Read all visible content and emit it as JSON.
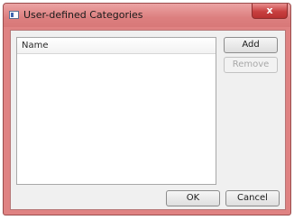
{
  "window": {
    "title": "User-defined Categories",
    "close_label": "x"
  },
  "list": {
    "columns": [
      "Name"
    ],
    "rows": []
  },
  "buttons": {
    "add": "Add",
    "remove": "Remove",
    "ok": "OK",
    "cancel": "Cancel"
  },
  "icons": {
    "app": "app-icon",
    "close": "close-icon"
  },
  "colors": {
    "titlebar": "#df8282",
    "client_bg": "#f0f0f0",
    "close_button": "#c84040"
  }
}
